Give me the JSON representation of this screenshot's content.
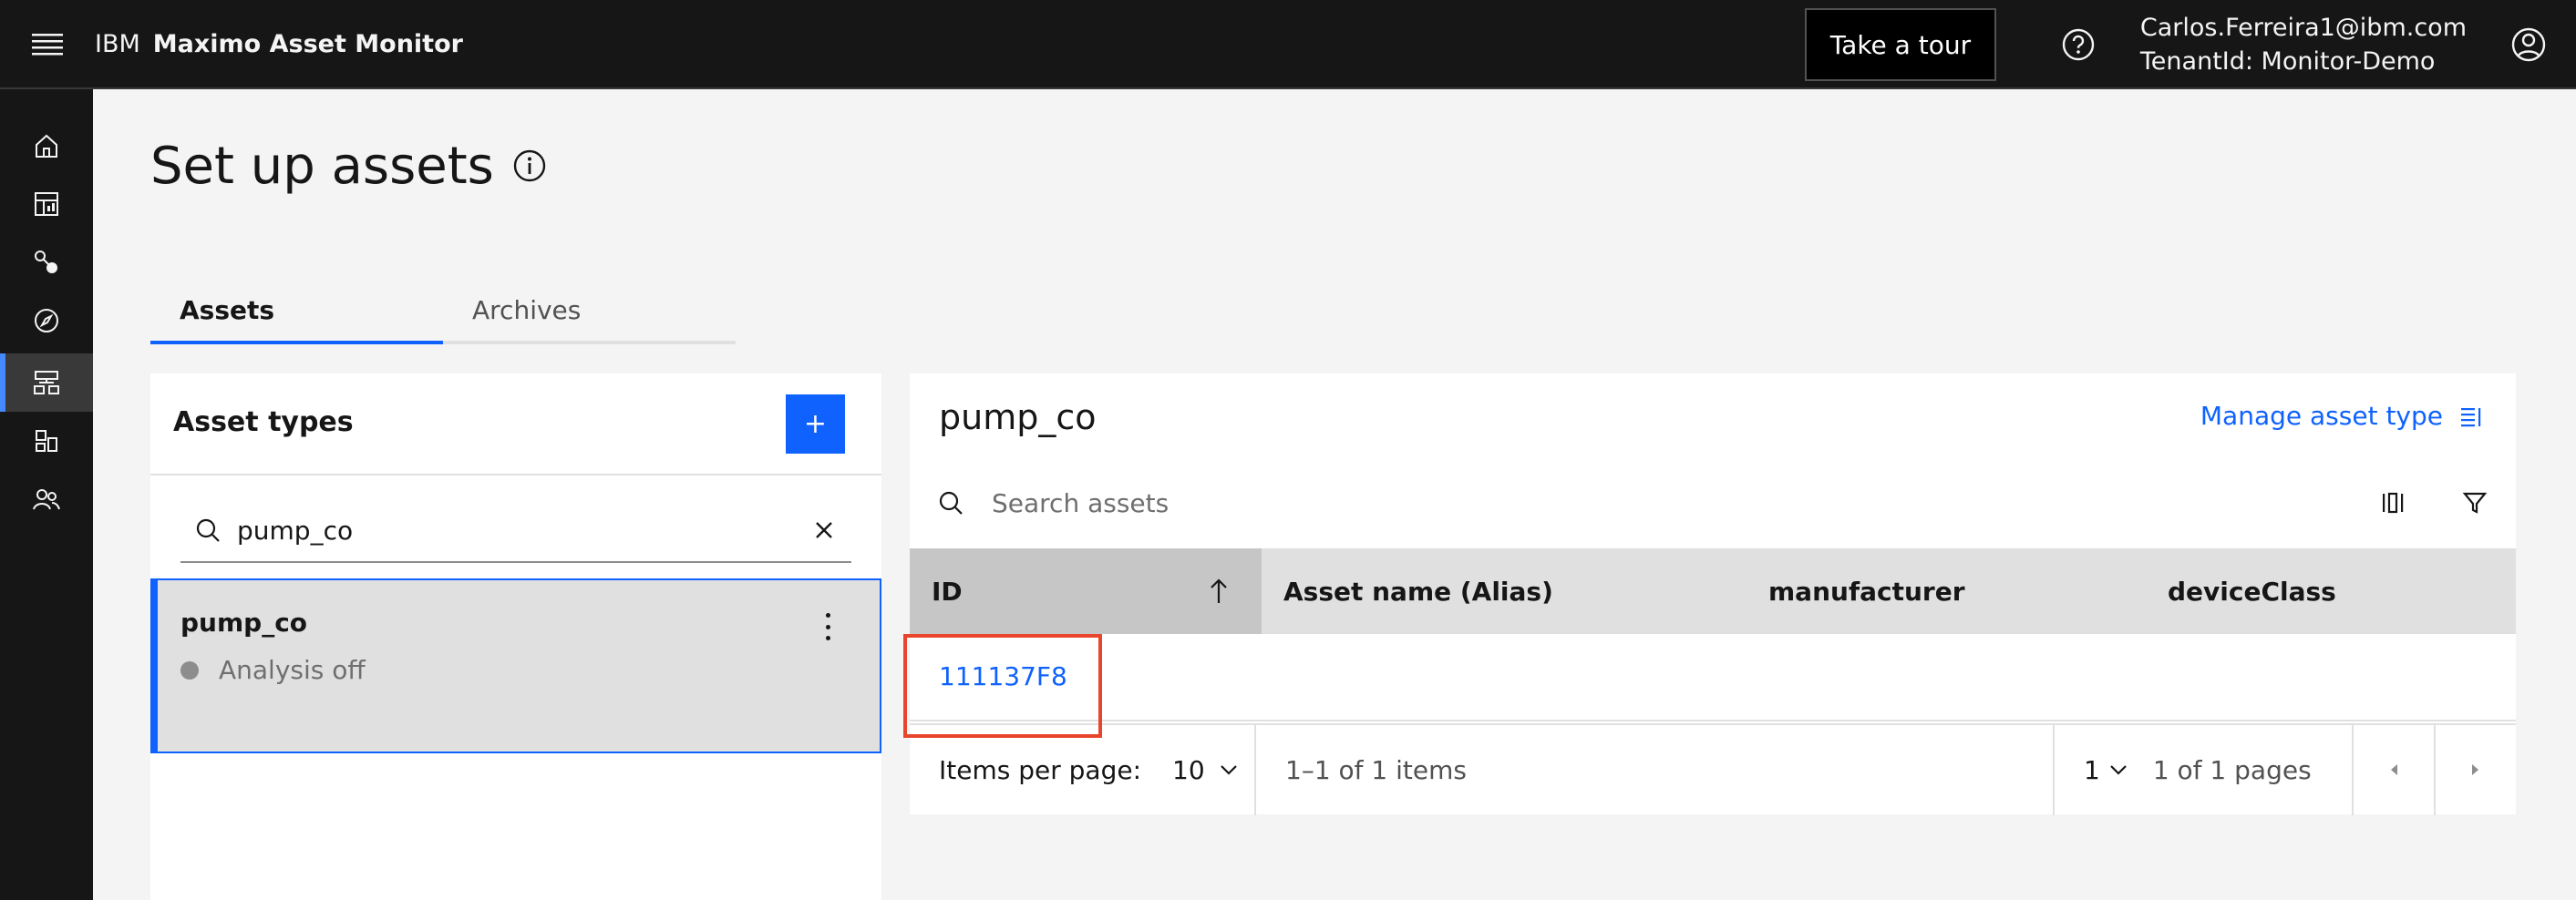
{
  "header": {
    "brand_prefix": "IBM",
    "brand_product": "Maximo Asset Monitor",
    "tour_label": "Take a tour",
    "user_email": "Carlos.Ferreira1@ibm.com",
    "tenant": "TenantId: Monitor-Demo"
  },
  "page": {
    "title": "Set up assets",
    "tabs": [
      {
        "label": "Assets",
        "active": true
      },
      {
        "label": "Archives",
        "active": false
      }
    ]
  },
  "asset_types": {
    "title": "Asset types",
    "add_label": "+",
    "search_value": "pump_co",
    "items": [
      {
        "name": "pump_co",
        "status": "Analysis off"
      }
    ]
  },
  "assets": {
    "title": "pump_co",
    "manage_label": "Manage asset type",
    "search_placeholder": "Search assets",
    "columns": [
      "ID",
      "Asset name (Alias)",
      "manufacturer",
      "deviceClass"
    ],
    "rows": [
      {
        "id": "111137F8",
        "name": "",
        "manufacturer": "",
        "deviceClass": ""
      }
    ],
    "pagination": {
      "items_per_page_label": "Items per page:",
      "items_per_page": "10",
      "range": "1–1 of 1 items",
      "page": "1",
      "pages": "1 of 1 pages"
    }
  },
  "colors": {
    "accent": "#0f62fe",
    "header_bg": "#161616",
    "highlight": "#e8452c"
  }
}
